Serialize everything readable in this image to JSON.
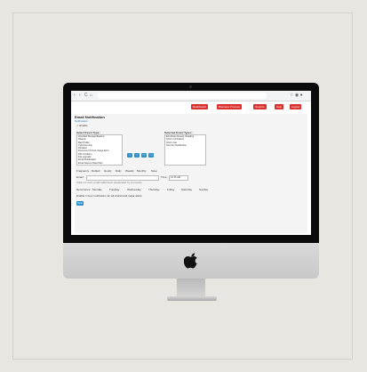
{
  "browser": {
    "back": "‹",
    "forward": "›",
    "reload": "C",
    "home": "⌂",
    "right_icons": "☆ ◉ ●"
  },
  "header": {
    "buttons": [
      "Dashboard",
      "Business Process",
      "Reports",
      "Help",
      "Logout"
    ]
  },
  "page": {
    "title": "Email Notification",
    "breadcrumb": "Notification",
    "enable_label": "✓ Enable",
    "select_event_label": "Select Event Type :",
    "selected_event_label": "Selected Event Types :",
    "available_events": [
      "Inherited Storage Backup",
      "Shared",
      "Bad Profile",
      "Cybersecurity",
      "Dictation",
      "Document Period Usage Error",
      "DR Condition",
      "File upgrade",
      "Email Notification",
      "Email Secure Data Plan",
      "Email Commissioning",
      "Email Directory"
    ],
    "selected_events": [
      "Errorbrary Emerg. Reading",
      "Inform Cd Failure",
      "Inform Set",
      "Security Notification"
    ],
    "arrows": [
      ">",
      "<",
      ">>",
      "<<"
    ],
    "frequency_label": "Frequency :",
    "frequency_options": [
      "Default",
      "Hourly",
      "Daily",
      "Weekly",
      "Monthly",
      "Save"
    ],
    "email_label": "Email :",
    "time_label": "Time :",
    "time_value": "10:15 AM",
    "email_help": "Click on more email addresses (separated by commas).",
    "days_label": "Recurrence :",
    "days": [
      "Monday",
      "Tuesday",
      "Wednesday",
      "Thursday",
      "Friday",
      "Saturday",
      "Sunday"
    ],
    "consolidate": "Enable 1 hour notification for all critical and major alerts",
    "save_button": "Save"
  }
}
